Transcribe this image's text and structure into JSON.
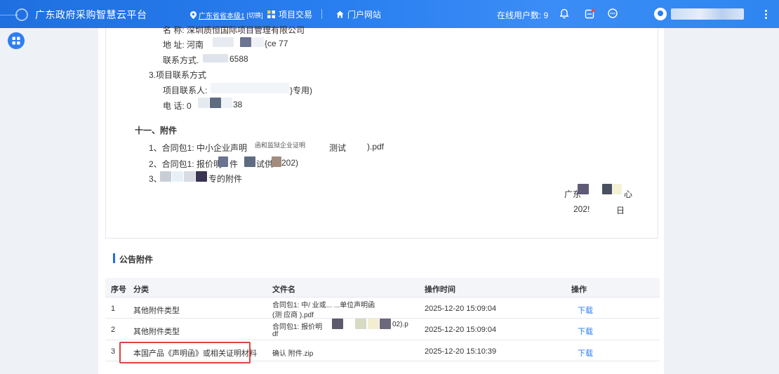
{
  "topbar": {
    "app_title": "广东政府采购智慧云平台",
    "region": "广东省省本级1",
    "region_switch": "[切换]",
    "nav_project": "项目交易",
    "nav_portal": "门户网站",
    "online_label": "在线用户数: 9",
    "user_name": ""
  },
  "document": {
    "line_name": "名  称: 深圳质恒国际项目管理有限公司",
    "line_addr": "地  址: 河南",
    "line_addr_tail": "{ce 77",
    "line_contact": "联系方式. ",
    "line_contact_tail": "6588",
    "heading_contact": "3.项目联系方式",
    "line_person": "项目联系人:",
    "line_person_tail": "}专用)",
    "line_phone": "电  话: 0",
    "line_phone_tail": "38",
    "section_attach": "十一、附件",
    "att1_pre": "1、合同包1: 中小企业声明",
    "att1_mid": "函和监狱企业证明",
    "att1_mid2": "测试",
    "att1_tail": ").pdf",
    "att2_pre": "2、合同包1: 报价明",
    "att2_mid": "件",
    "att2_mid2": "试供",
    "att2_tail": "202)",
    "att3_pre": "3、",
    "att3_tail": "专的附件",
    "sign_org": "广东",
    "sign_org_tail": "心",
    "sign_date": "202!",
    "sign_date_tail": "日"
  },
  "section": {
    "title": "公告附件"
  },
  "table": {
    "headers": [
      "序号",
      "分类",
      "文件名",
      "操作时间",
      "操作"
    ],
    "rows": [
      {
        "no": "1",
        "category": "其他附件类型",
        "file_l1": "合同包1: 中/  业或...   ...单位声明函",
        "file_l2": "(测   应商     ).pdf",
        "time": "2025-12-20 15:09:04",
        "action": "下载"
      },
      {
        "no": "2",
        "category": "其他附件类型",
        "file_l1": "合同包1: 报价明",
        "file_l1_tail": "02).p",
        "file_l2": "df",
        "time": "2025-12-20 15:09:04",
        "action": "下载"
      },
      {
        "no": "3",
        "category": "本国产品《声明函》或相关证明材料",
        "file_l1": "确认            附件.zip",
        "file_l2": "",
        "time": "2025-12-20 15:10:39",
        "action": "下载"
      }
    ]
  },
  "colors": {
    "topbar": "#2a7ff0",
    "link": "#2a7ff0",
    "highlight_border": "#e0433f",
    "header_bg": "#f3f5f8"
  }
}
